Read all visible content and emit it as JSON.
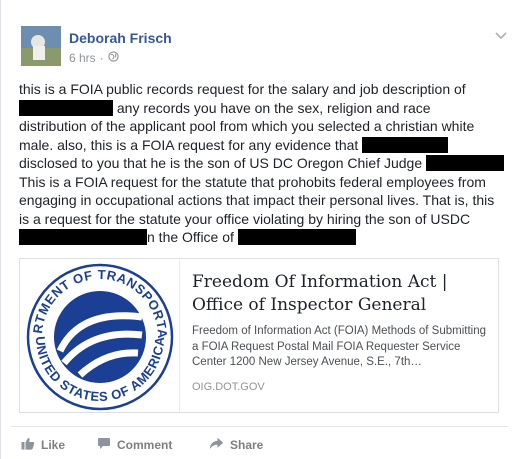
{
  "post": {
    "author": "Deborah Frisch",
    "time": "6 hrs",
    "separator": "·",
    "text": {
      "l1": "this is a FOIA public records request for the salary and job description of",
      "l2": " any records you have on the sex, religion and race",
      "l3": "distribution of the applicant pool from which you selected a christian white",
      "l4a": "male. also, this is a FOIA request for any evidence that ",
      "l5": "disclosed to you that he is the son of US DC Oregon Chief Judge ",
      "l6": "This is a FOIA request for the statute that prohobits federal employees from",
      "l7": "engaging in occupational actions that impact their personal lives. That is, this",
      "l8": "is a request for the statute your office violating by hiring the son of USDC",
      "l9a": "n the Office of "
    }
  },
  "link_preview": {
    "seal_text_top": "DEPARTMENT OF TRANSPORTATION",
    "seal_text_bottom": "UNITED STATES OF AMERICA",
    "title": "Freedom Of Information Act | Office of Inspector General",
    "description": "Freedom of Information Act (FOIA) Methods of Submitting a FOIA Request Postal Mail FOIA Requester Service Center 1200 New Jersey Avenue, S.E., 7th…",
    "domain": "OIG.DOT.GOV"
  },
  "actions": {
    "like": "Like",
    "comment": "Comment",
    "share": "Share"
  },
  "icons": {
    "privacy": "globe-icon",
    "menu": "chevron-down-icon",
    "like": "thumbs-up-icon",
    "comment": "speech-bubble-icon",
    "share": "share-arrow-icon"
  },
  "colors": {
    "author_link": "#365899",
    "meta": "#90949c",
    "action": "#7f7f7f",
    "seal_blue": "#1b3f94"
  }
}
